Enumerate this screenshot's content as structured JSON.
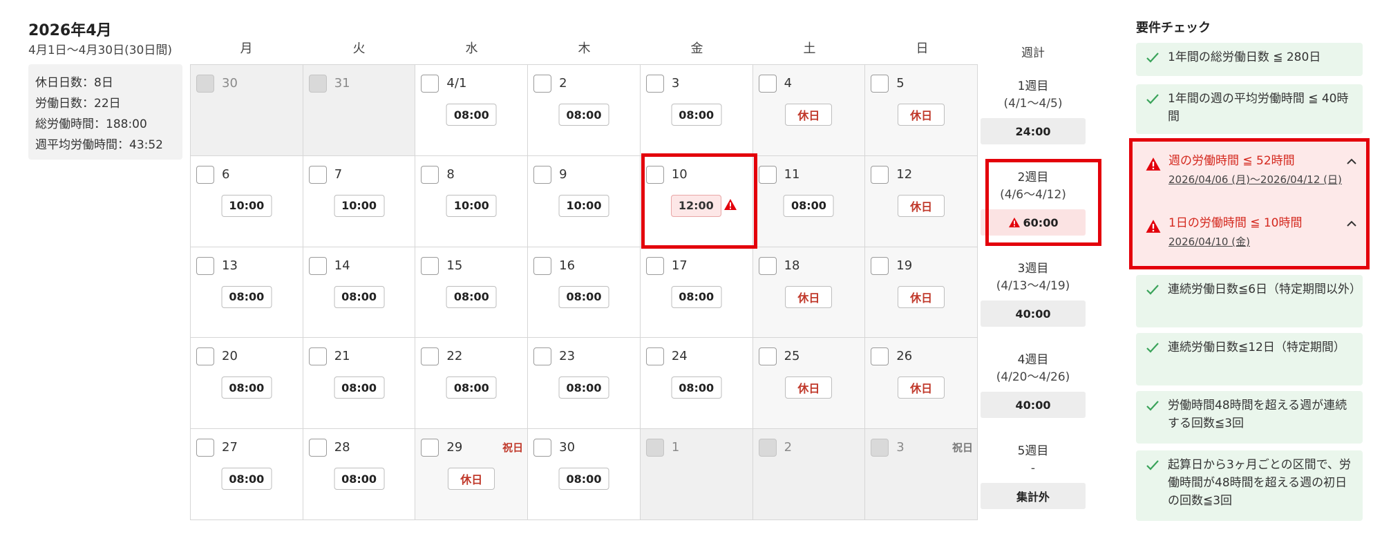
{
  "summary": {
    "month_title": "2026年4月",
    "date_range": "4月1日～4月30日(30日間)",
    "lines": [
      "休日日数：8日",
      "労働日数：22日",
      "総労働時間：188:00",
      "週平均労働時間：43:52"
    ]
  },
  "calendar": {
    "weekdays": [
      "月",
      "火",
      "水",
      "木",
      "金",
      "土",
      "日"
    ],
    "week_total_header": "週計",
    "cells": [
      {
        "day": "30",
        "hours": ""
      },
      {
        "day": "31",
        "hours": ""
      },
      {
        "day": "4/1",
        "hours": "08:00"
      },
      {
        "day": "2",
        "hours": "08:00"
      },
      {
        "day": "3",
        "hours": "08:00"
      },
      {
        "day": "4",
        "hours": "休日"
      },
      {
        "day": "5",
        "hours": "休日"
      },
      {
        "day": "6",
        "hours": "10:00"
      },
      {
        "day": "7",
        "hours": "10:00"
      },
      {
        "day": "8",
        "hours": "10:00"
      },
      {
        "day": "9",
        "hours": "10:00"
      },
      {
        "day": "10",
        "hours": "12:00"
      },
      {
        "day": "11",
        "hours": "08:00"
      },
      {
        "day": "12",
        "hours": "休日"
      },
      {
        "day": "13",
        "hours": "08:00"
      },
      {
        "day": "14",
        "hours": "08:00"
      },
      {
        "day": "15",
        "hours": "08:00"
      },
      {
        "day": "16",
        "hours": "08:00"
      },
      {
        "day": "17",
        "hours": "08:00"
      },
      {
        "day": "18",
        "hours": "休日"
      },
      {
        "day": "19",
        "hours": "休日"
      },
      {
        "day": "20",
        "hours": "08:00"
      },
      {
        "day": "21",
        "hours": "08:00"
      },
      {
        "day": "22",
        "hours": "08:00"
      },
      {
        "day": "23",
        "hours": "08:00"
      },
      {
        "day": "24",
        "hours": "08:00"
      },
      {
        "day": "25",
        "hours": "休日"
      },
      {
        "day": "26",
        "hours": "休日"
      },
      {
        "day": "27",
        "hours": "08:00"
      },
      {
        "day": "28",
        "hours": "08:00"
      },
      {
        "day": "29",
        "hours": "休日",
        "tag": "祝日"
      },
      {
        "day": "30",
        "hours": "08:00"
      },
      {
        "day": "1",
        "hours": ""
      },
      {
        "day": "2",
        "hours": ""
      },
      {
        "day": "3",
        "hours": "",
        "tag": "祝日"
      }
    ],
    "weeks": [
      {
        "title": "1週目",
        "range": "(4/1～4/5)",
        "total": "24:00"
      },
      {
        "title": "2週目",
        "range": "(4/6～4/12)",
        "total": "60:00"
      },
      {
        "title": "3週目",
        "range": "(4/13～4/19)",
        "total": "40:00"
      },
      {
        "title": "4週目",
        "range": "(4/20～4/26)",
        "total": "40:00"
      },
      {
        "title": "5週目",
        "range": "-",
        "total": "集計外"
      }
    ]
  },
  "requirements": {
    "title": "要件チェック",
    "passed": [
      "1年間の総労働日数 ≦ 280日",
      "1年間の週の平均労働時間 ≦ 40時間",
      "連続労働日数≦6日（特定期間以外）",
      "連続労働日数≦12日（特定期間）",
      "労働時間48時間を超える週が連続する回数≦3回",
      "起算日から3ヶ月ごとの区間で、労働時間が48時間を超える週の初日の回数≦3回"
    ],
    "failed": [
      {
        "title": "週の労働時間 ≦ 52時間",
        "detail": "2026/04/06 (月)～2026/04/12 (日)"
      },
      {
        "title": "1日の労働時間 ≦ 10時間",
        "detail": "2026/04/10 (金)"
      }
    ]
  },
  "colors": {
    "error": "#e3000b",
    "pass_bg": "#eaf6ec",
    "pass_check": "#3aa35a",
    "holiday": "#c0392b"
  }
}
